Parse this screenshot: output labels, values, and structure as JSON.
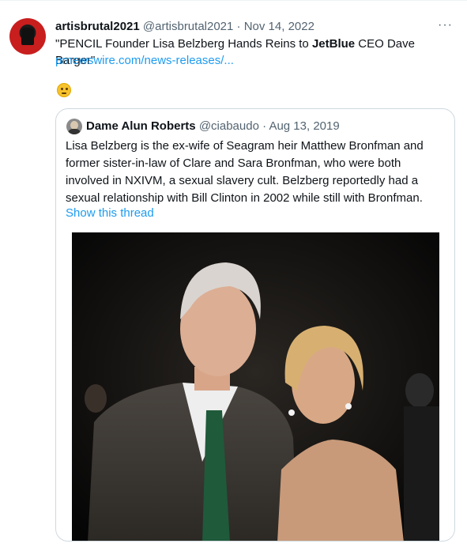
{
  "tweet": {
    "author_name": "artisbrutal2021",
    "author_handle": "@artisbrutal2021",
    "separator": "·",
    "date": "Nov 14, 2022",
    "more_icon": "more-icon",
    "text_prefix": "\"PENCIL Founder Lisa Belzberg Hands Reins to ",
    "text_bold": "JetBlue",
    "text_suffix": " CEO Dave Barger\"",
    "link": "prnewswire.com/news-releases/...",
    "emoji": "thinking-face"
  },
  "quote": {
    "author_name": "Dame Alun Roberts",
    "author_handle": "@ciabaudo",
    "separator": "·",
    "date": "Aug 13, 2019",
    "text": "Lisa Belzberg is the ex-wife of Seagram heir Matthew Bronfman and former sister-in-law of Clare and Sara Bronfman, who were both involved in NXIVM, a sexual slavery cult. Belzberg reportedly had a sexual relationship with Bill Clinton in 2002 while still with Bronfman.",
    "thread_link": "Show this thread"
  },
  "colors": {
    "accent": "#1d9bf0",
    "secondary_text": "#536471",
    "border": "#cfd9de"
  }
}
